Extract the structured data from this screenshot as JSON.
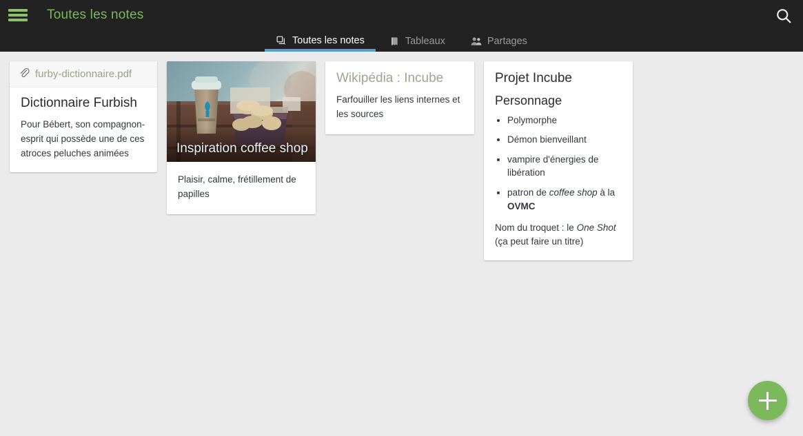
{
  "header": {
    "menu_icon": "hamburger-icon",
    "title": "Toutes les notes",
    "search_icon": "search-icon"
  },
  "tabs": [
    {
      "label": "Toutes les notes",
      "icon": "notes-stack-icon",
      "active": true
    },
    {
      "label": "Tableaux",
      "icon": "notebook-icon",
      "active": false
    },
    {
      "label": "Partages",
      "icon": "people-icon",
      "active": false
    }
  ],
  "cards": [
    {
      "id": "furby",
      "attachment": "furby-dictionnaire.pdf",
      "attachment_icon": "paperclip-icon",
      "title": "Dictionnaire Furbish",
      "text": "Pour Bébert, son compagnon-esprit qui possède une de ces atroces peluches animées"
    },
    {
      "id": "coffee",
      "photo_caption": "Inspiration coffee shop",
      "photo_alt": "coffee-cup-and-macarons-photo",
      "text": "Plaisir, calme, frétillement de papilles"
    },
    {
      "id": "wikipedia",
      "title": "Wikipédia : Incube",
      "text": "Farfouiller les liens internes et les sources"
    },
    {
      "id": "projet",
      "title": "Projet Incube",
      "subheading": "Personnage",
      "bullets": [
        {
          "plain": "Polymorphe"
        },
        {
          "plain": "Démon bienveillant"
        },
        {
          "plain": "vampire d'énergies de libération"
        },
        {
          "prefix": "patron de ",
          "italic": "coffee shop",
          "middle": " à la ",
          "bold": "OVMC"
        }
      ],
      "footnote_prefix": "Nom du troquet : le ",
      "footnote_italic": "One Shot",
      "footnote_suffix": " (ça peut faire un titre)"
    }
  ],
  "fab": {
    "label": "+",
    "icon": "plus-icon",
    "color": "#7cb85c"
  },
  "colors": {
    "header_bg": "#222222",
    "accent_green": "#7db758",
    "tab_active_underline": "#5b9bd5",
    "page_bg": "#ebebeb",
    "card_bg": "#ffffff"
  }
}
